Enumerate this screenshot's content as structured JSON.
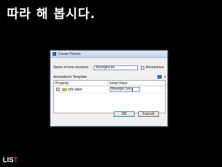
{
  "slide": {
    "title": "따라 해 봅시다.",
    "logo": {
      "main": "LIS",
      "accent": "T"
    }
  },
  "dialog": {
    "title": "Create Person",
    "name_label": "Name of new resource:",
    "name_value": "MyunginLee",
    "anonymous_label": "Anonymous",
    "annotations_label": "Annotations Template",
    "annotations_remove": "x",
    "table": {
      "headers": [
        "Property",
        "Initial Value"
      ],
      "rows": [
        {
          "property": "rdfs:label",
          "checked": "✓",
          "value": "Myungin Lee"
        }
      ]
    },
    "ok_label": "OK",
    "cancel_label": "Cancel"
  },
  "colors": {
    "background": "#000000",
    "logo_accent": "#e2211c",
    "folder": "#e8c24a"
  },
  "icons": [
    "app-icon",
    "add-annotation-icon",
    "remove-annotation-icon",
    "folder-icon",
    "checkbox-icon"
  ]
}
